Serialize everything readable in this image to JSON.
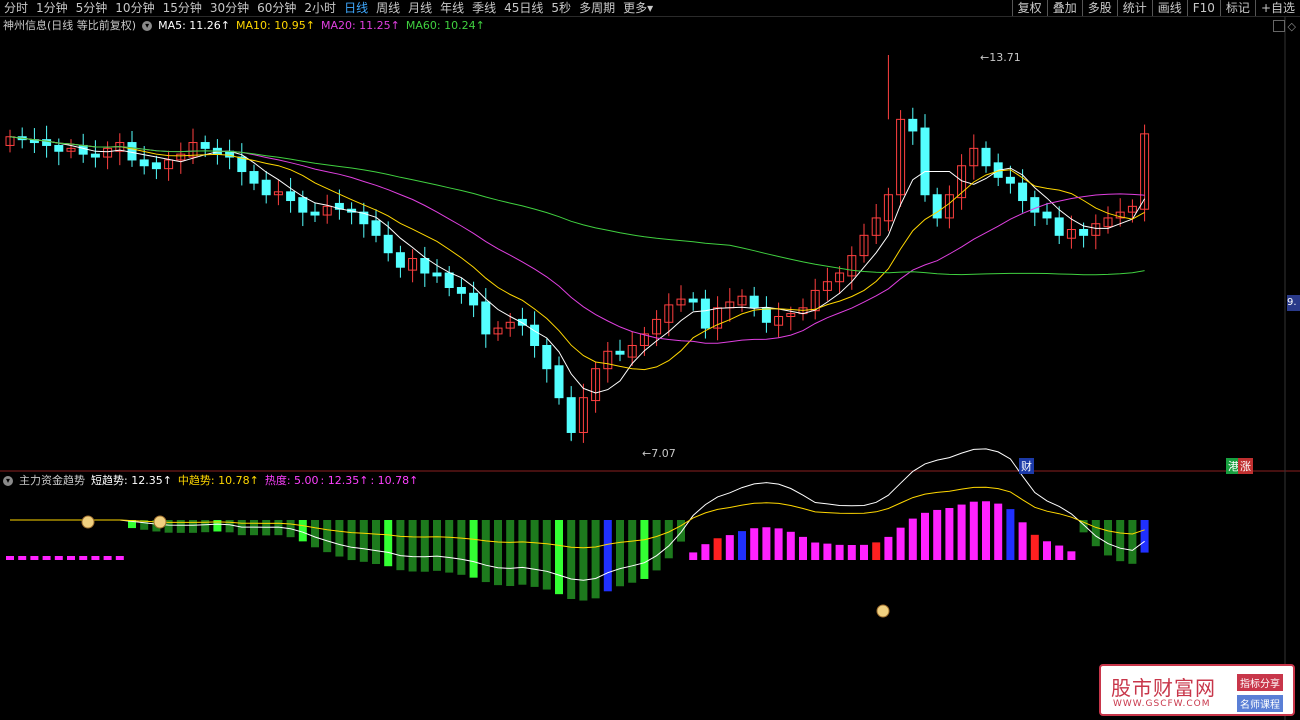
{
  "toolbar": {
    "tabs": [
      "分时",
      "1分钟",
      "5分钟",
      "10分钟",
      "15分钟",
      "30分钟",
      "60分钟",
      "2小时",
      "日线",
      "周线",
      "月线",
      "年线",
      "季线",
      "45日线",
      "5秒",
      "多周期",
      "更多"
    ],
    "active_tab": "日线",
    "more_arrow": "▾",
    "right_tools": [
      "复权",
      "叠加",
      "多股",
      "统计",
      "画线",
      "F10",
      "标记",
      "+自选"
    ]
  },
  "main_legend": {
    "stock_name": "神州信息(日线 等比前复权)",
    "ma5": "MA5: 11.26↑",
    "ma10": "MA10: 10.95↑",
    "ma20": "MA20: 11.25↑",
    "ma60": "MA60: 10.24↑",
    "colors": {
      "ma5": "#ffffff",
      "ma10": "#ffd700",
      "ma20": "#e040e0",
      "ma60": "#40d040"
    }
  },
  "annotations": {
    "high_label": "13.71",
    "low_label": "7.07",
    "right_axis_value": "9.",
    "cai_badge": "财",
    "gang_badge": "港",
    "zhang_badge": "涨"
  },
  "sub_legend": {
    "indicator_name": "主力资金趋势",
    "short": "短趋势: 12.35↑",
    "mid": "中趋势: 10.78↑",
    "heat_label": "热度: 5.00",
    "heat_v1": ": 12.35↑",
    "heat_v2": ": 10.78↑",
    "colors": {
      "short": "#ffffff",
      "mid": "#ffd700",
      "heat": "#ff40ff"
    }
  },
  "watermark": {
    "title": "股市财富网",
    "url": "WWW.GSCFW.COM",
    "badge1": "指标分享",
    "badge2": "名师课程"
  },
  "chart_data": [
    {
      "type": "candlestick",
      "ylim": [
        7.07,
        13.71
      ],
      "high": 13.71,
      "low": 7.07,
      "last_close": 12.35,
      "series": [
        {
          "name": "MA5",
          "value": 11.26
        },
        {
          "name": "MA10",
          "value": 10.95
        },
        {
          "name": "MA20",
          "value": 11.25
        },
        {
          "name": "MA60",
          "value": 10.24
        }
      ],
      "closes": [
        12.3,
        12.25,
        12.2,
        12.15,
        12.05,
        12.1,
        12.0,
        11.95,
        12.1,
        12.2,
        11.9,
        11.8,
        11.75,
        11.9,
        12.0,
        12.2,
        12.1,
        12.0,
        11.95,
        11.7,
        11.5,
        11.3,
        11.35,
        11.2,
        11.0,
        10.95,
        11.1,
        11.05,
        11.0,
        10.8,
        10.6,
        10.3,
        10.05,
        10.2,
        9.95,
        9.9,
        9.7,
        9.6,
        9.4,
        8.9,
        9.0,
        9.1,
        9.05,
        8.7,
        8.3,
        7.8,
        7.2,
        7.8,
        8.3,
        8.6,
        8.55,
        8.7,
        8.9,
        9.15,
        9.4,
        9.5,
        9.45,
        9.0,
        9.35,
        9.45,
        9.55,
        9.35,
        9.1,
        9.2,
        9.25,
        9.35,
        9.65,
        9.8,
        9.95,
        10.25,
        10.6,
        10.9,
        11.3,
        12.6,
        12.4,
        11.3,
        10.9,
        11.3,
        11.8,
        12.1,
        11.8,
        11.6,
        11.5,
        11.2,
        11.0,
        10.9,
        10.6,
        10.7,
        10.6,
        10.8,
        10.9,
        11.0,
        11.1,
        12.35
      ]
    },
    {
      "type": "bar",
      "title": "主力资金趋势",
      "series": [
        {
          "name": "短趋势",
          "value": 12.35
        },
        {
          "name": "中趋势",
          "value": 10.78
        },
        {
          "name": "热度",
          "value": 5.0
        }
      ]
    }
  ]
}
